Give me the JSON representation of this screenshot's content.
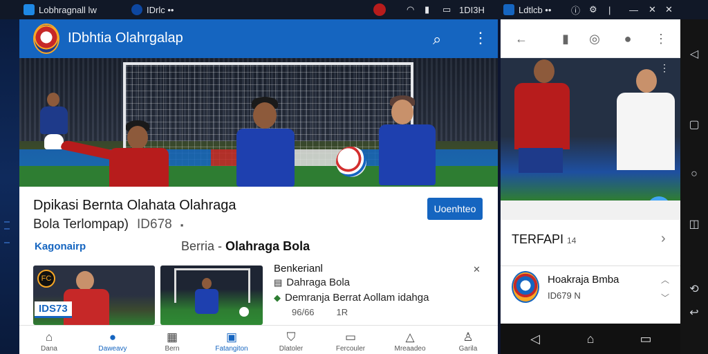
{
  "taskbar": {
    "app1_title": "Lobhragnall lw",
    "app2_title": "IDrlc ••",
    "clock": "1DI3H",
    "app3_title": "Ldtlcb ••"
  },
  "app": {
    "title": "IDbhtia Olahrgalap",
    "headline": "Dpikasi Bernta Olahata Olahraga",
    "subline_text": "Bola Terlompap)",
    "subline_id": "ID678",
    "subline_tail": "—",
    "cta": "Uoenhteo",
    "section_link": "Kagonairp",
    "crumb_left": "Berria",
    "crumb_sep": "-",
    "crumb_right": "Olahraga Bola",
    "thumb_badge": "IDS73",
    "news_title": "Benkerianl",
    "news_close": "x",
    "news_row1": "Dahraga Bola",
    "news_row2": "Demranja Berrat Aollam idahga",
    "news_meta_a": "96/66",
    "news_meta_b": "1R"
  },
  "bottom_nav": [
    {
      "label": "Dana",
      "icon": "home-icon"
    },
    {
      "label": "Daweavy",
      "icon": "info-icon"
    },
    {
      "label": "Bern",
      "icon": "grid-icon"
    },
    {
      "label": "Fatangiton",
      "icon": "bag-icon"
    },
    {
      "label": "Dlatoler",
      "icon": "shield-icon"
    },
    {
      "label": "Fercouler",
      "icon": "card-icon"
    },
    {
      "label": "Mreaadeo",
      "icon": "bell-icon"
    },
    {
      "label": "Garila",
      "icon": "person-icon"
    }
  ],
  "panel": {
    "section_title": "TERFAPI",
    "section_suffix": "14",
    "item_title": "Hoakraja Bmba",
    "item_sub": "ID679",
    "item_sub_suffix": "N"
  },
  "colors": {
    "primary": "#1565c0",
    "accent_red": "#c62828",
    "pitch": "#2e7d32"
  }
}
